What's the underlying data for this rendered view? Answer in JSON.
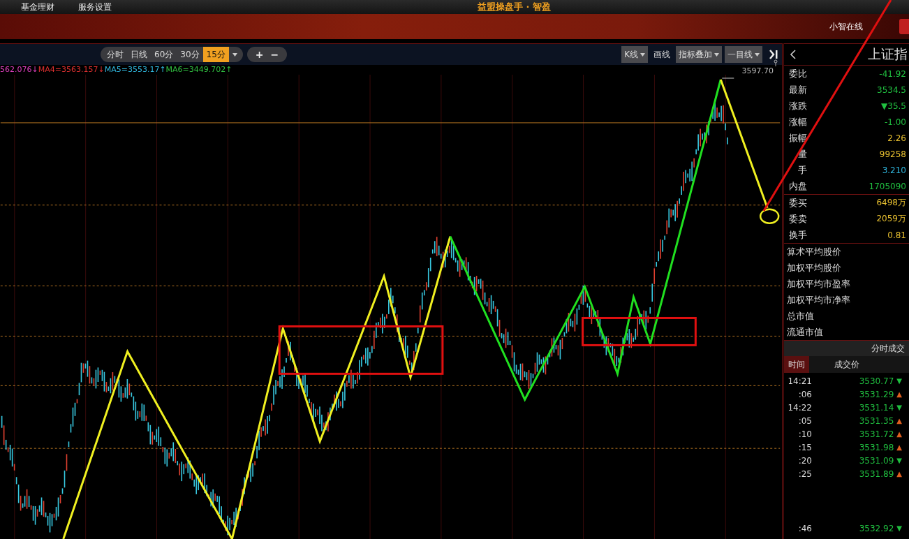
{
  "menu": [
    "基金理财",
    "服务设置"
  ],
  "app_title": "益盟操盘手 · 智盈",
  "online_status": "小智在线",
  "period_tabs": [
    {
      "label": "分时",
      "selected": false
    },
    {
      "label": "日线",
      "selected": false
    },
    {
      "label": "60分",
      "selected": false
    },
    {
      "label": "30分",
      "selected": false
    },
    {
      "label": "15分",
      "selected": true
    }
  ],
  "zoom_buttons": [
    "+",
    "−"
  ],
  "tools": [
    {
      "label": "K线",
      "dropdown": true
    },
    {
      "label": "画线",
      "dropdown": false
    },
    {
      "label": "指标叠加",
      "dropdown": true
    },
    {
      "label": "一目线",
      "dropdown": true
    }
  ],
  "ma_legend": [
    {
      "text": "562.076↓",
      "color": "#e040c0"
    },
    {
      "text": "MA4=3563.157↓",
      "color": "#e03030"
    },
    {
      "text": "MA5=3553.17↑",
      "color": "#30b8e0"
    },
    {
      "text": "MA6=3449.702↑",
      "color": "#30c040"
    }
  ],
  "chart": {
    "high_label": "3597.70"
  },
  "quote_panel": {
    "title": "上证指",
    "stats": [
      {
        "label": "委比",
        "value": "-41.92",
        "color": "#20c040"
      },
      {
        "label": "最新",
        "value": "3534.5",
        "color": "#20c040"
      },
      {
        "label": "涨跌",
        "value": "▼35.5",
        "color": "#20c040"
      },
      {
        "label": "涨幅",
        "value": "-1.00",
        "color": "#20c040"
      },
      {
        "label": "振幅",
        "value": "2.26",
        "color": "#e8c030"
      },
      {
        "label": "量",
        "value": "99258",
        "color": "#e8c030"
      },
      {
        "label": "手",
        "value": "3.210",
        "color": "#30b8e0"
      },
      {
        "label": "内盘",
        "value": "1705090",
        "color": "#20c040"
      }
    ],
    "orders": [
      {
        "label": "委买",
        "value": "6498万",
        "color": "#e8c030"
      },
      {
        "label": "委卖",
        "value": "2059万",
        "color": "#e8c030"
      },
      {
        "label": "换手",
        "value": "0.81",
        "color": "#e8c030"
      }
    ],
    "indicators": [
      "算术平均股价",
      "加权平均股价",
      "加权平均市盈率",
      "加权平均市净率",
      "总市值",
      "流通市值"
    ]
  },
  "ticks_panel": {
    "title": "分时成交",
    "columns": [
      {
        "label": "时间",
        "selected": true
      },
      {
        "label": "成交价",
        "selected": false
      }
    ],
    "rows": [
      {
        "time": "14:21",
        "price": "3530.77",
        "arrow": "▼",
        "color": "#20c040"
      },
      {
        "time": ":06",
        "price": "3531.29",
        "arrow": "▲",
        "color": "#e06020"
      },
      {
        "time": "14:22",
        "price": "3531.14",
        "arrow": "▼",
        "color": "#20c040"
      },
      {
        "time": ":05",
        "price": "3531.35",
        "arrow": "▲",
        "color": "#e06020"
      },
      {
        "time": ":10",
        "price": "3531.72",
        "arrow": "▲",
        "color": "#e06020"
      },
      {
        "time": ":15",
        "price": "3531.98",
        "arrow": "▲",
        "color": "#e06020"
      },
      {
        "time": ":20",
        "price": "3531.09",
        "arrow": "▼",
        "color": "#20c040"
      },
      {
        "time": ":25",
        "price": "3531.89",
        "arrow": "▲",
        "color": "#e06020"
      },
      {
        "time": ":46",
        "price": "3532.92",
        "arrow": "▼",
        "color": "#20c040"
      }
    ]
  }
}
